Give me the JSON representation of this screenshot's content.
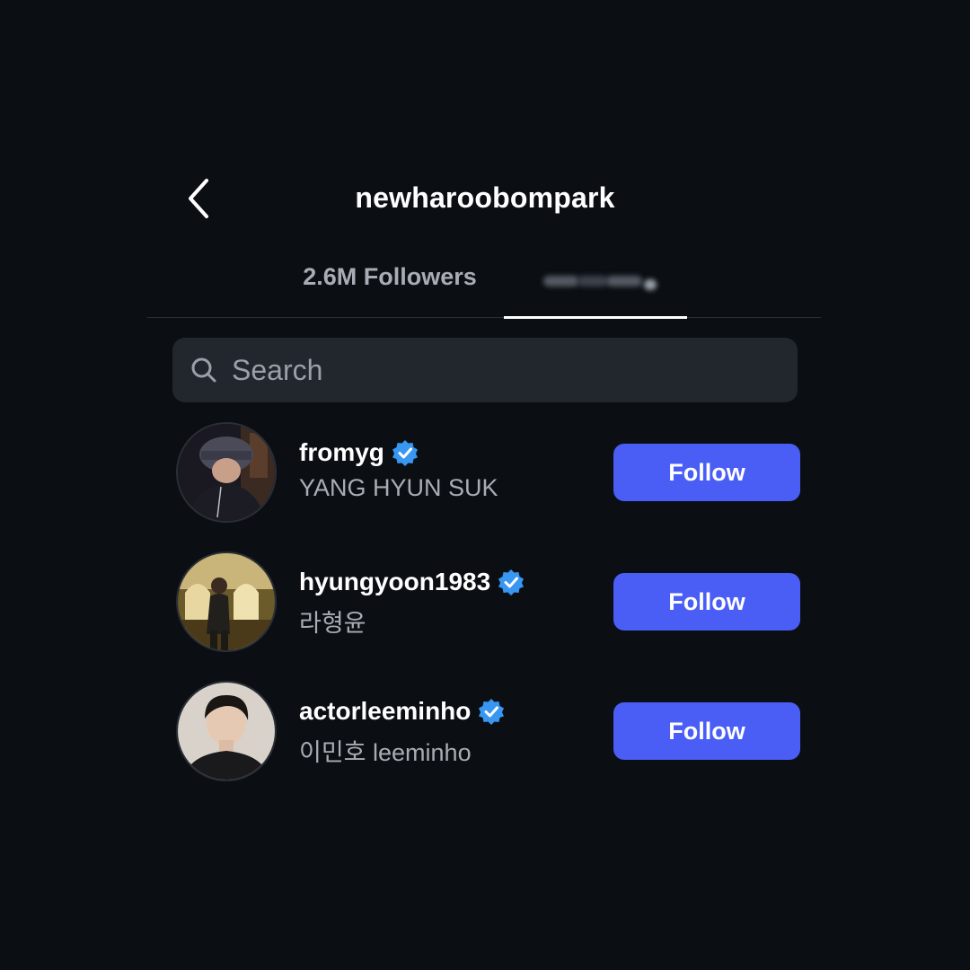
{
  "header": {
    "title": "newharoobompark",
    "back_icon": "chevron-left-icon"
  },
  "tabs": [
    {
      "label": "2.6M Followers",
      "active": false
    },
    {
      "label": "",
      "active": true,
      "obscured": true
    }
  ],
  "search": {
    "placeholder": "Search",
    "value": "",
    "icon": "search-icon"
  },
  "users": [
    {
      "username": "fromyg",
      "full_name": "YANG HYUN SUK",
      "verified": true,
      "button_label": "Follow"
    },
    {
      "username": "hyungyoon1983",
      "full_name": "라형윤",
      "verified": true,
      "button_label": "Follow"
    },
    {
      "username": "actorleeminho",
      "full_name": "이민호 leeminho",
      "verified": true,
      "button_label": "Follow"
    }
  ],
  "colors": {
    "background": "#0b0f14",
    "search_background": "#22262d",
    "follow_button": "#4a5ef5",
    "verified_badge": "#3897f0",
    "secondary_text": "#a8adb5"
  }
}
